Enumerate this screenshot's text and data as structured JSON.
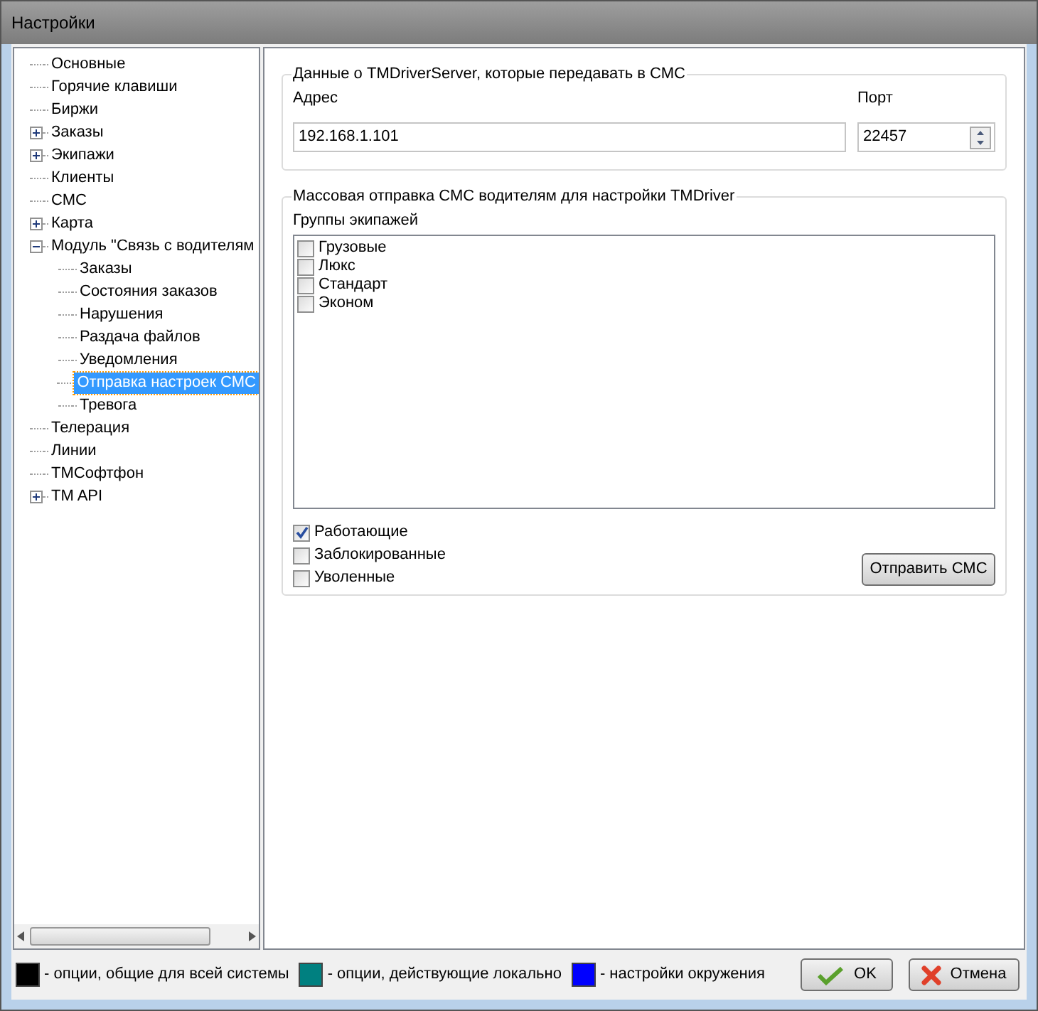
{
  "window": {
    "title": "Настройки"
  },
  "tree": [
    {
      "label": "Основные",
      "kind": "leaf",
      "selected": false
    },
    {
      "label": "Горячие клавиши",
      "kind": "leaf",
      "selected": false
    },
    {
      "label": "Биржи",
      "kind": "leaf",
      "selected": false
    },
    {
      "label": "Заказы",
      "kind": "folder",
      "expanded": false,
      "selected": false
    },
    {
      "label": "Экипажи",
      "kind": "folder",
      "expanded": false,
      "selected": false
    },
    {
      "label": "Клиенты",
      "kind": "leaf",
      "selected": false
    },
    {
      "label": "СМС",
      "kind": "leaf",
      "selected": false
    },
    {
      "label": "Карта",
      "kind": "folder",
      "expanded": false,
      "selected": false
    },
    {
      "label": "Модуль \"Связь с водителям",
      "kind": "folder",
      "expanded": true,
      "selected": false,
      "children": [
        {
          "label": "Заказы",
          "kind": "leaf",
          "selected": false
        },
        {
          "label": "Состояния заказов",
          "kind": "leaf",
          "selected": false
        },
        {
          "label": "Нарушения",
          "kind": "leaf",
          "selected": false
        },
        {
          "label": "Раздача файлов",
          "kind": "leaf",
          "selected": false
        },
        {
          "label": "Уведомления",
          "kind": "leaf",
          "selected": false
        },
        {
          "label": "Отправка настроек СМС",
          "kind": "leaf",
          "selected": true
        },
        {
          "label": "Тревога",
          "kind": "leaf",
          "selected": false
        }
      ]
    },
    {
      "label": "Телерация",
      "kind": "leaf",
      "selected": false
    },
    {
      "label": "Линии",
      "kind": "leaf",
      "selected": false
    },
    {
      "label": "ТМСофтфон",
      "kind": "leaf",
      "selected": false
    },
    {
      "label": "TM API",
      "kind": "folder",
      "expanded": false,
      "selected": false
    }
  ],
  "server_group": {
    "title": "Данные о TMDriverServer, которые передавать в СМС",
    "address_label": "Адрес",
    "address_value": "192.168.1.101",
    "port_label": "Порт",
    "port_value": "22457"
  },
  "mass_group": {
    "title": "Массовая отправка СМС водителям для настройки TMDriver",
    "list_label": "Группы экипажей",
    "groups": [
      {
        "label": "Грузовые",
        "checked": false
      },
      {
        "label": "Люкс",
        "checked": false
      },
      {
        "label": "Стандарт",
        "checked": false
      },
      {
        "label": "Эконом",
        "checked": false
      }
    ],
    "filters": [
      {
        "label": "Работающие",
        "checked": true
      },
      {
        "label": "Заблокированные",
        "checked": false
      },
      {
        "label": "Уволенные",
        "checked": false
      }
    ],
    "send_button": "Отправить СМС"
  },
  "legend": [
    {
      "label": "- опции, общие для всей системы",
      "color": "#000000"
    },
    {
      "label": "- опции, действующие локально",
      "color": "#008080"
    },
    {
      "label": "- настройки окружения",
      "color": "#0000ff"
    }
  ],
  "buttons": {
    "ok": "OK",
    "cancel": "Отмена"
  }
}
